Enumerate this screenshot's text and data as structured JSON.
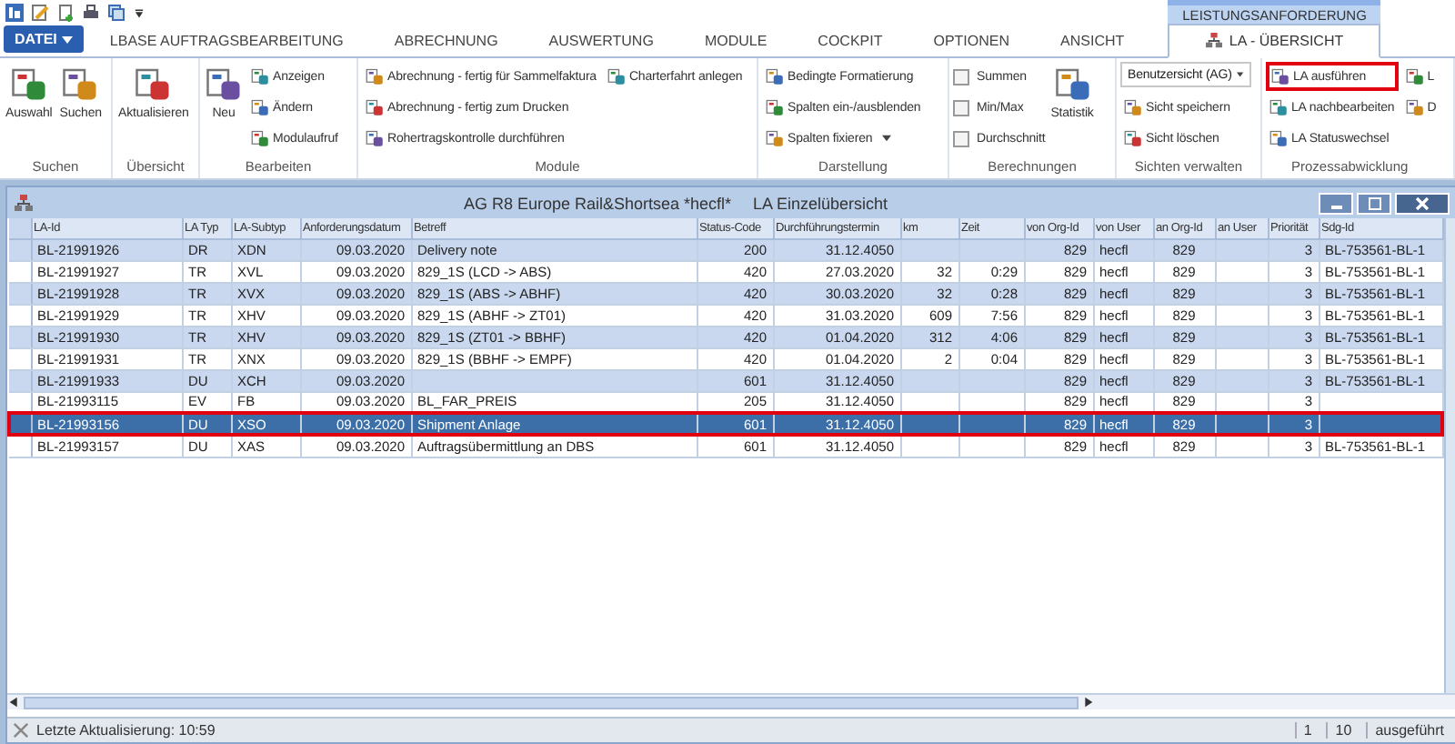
{
  "file_button": "DATEI",
  "context_group": "LEISTUNGSANFORDERUNG",
  "tabs": [
    {
      "label": "LBASE AUFTRAGSBEARBEITUNG",
      "selected": false
    },
    {
      "label": "ABRECHNUNG",
      "selected": false
    },
    {
      "label": "AUSWERTUNG",
      "selected": false
    },
    {
      "label": "MODULE",
      "selected": false
    },
    {
      "label": "COCKPIT",
      "selected": false
    },
    {
      "label": "OPTIONEN",
      "selected": false
    },
    {
      "label": "ANSICHT",
      "selected": false
    },
    {
      "label": "LA - ÜBERSICHT",
      "selected": true
    }
  ],
  "ribbon_groups": [
    {
      "label": "Suchen",
      "columns": [
        [
          {
            "kind": "large",
            "label": "Auswahl"
          }
        ],
        [
          {
            "kind": "large",
            "label": "Suchen"
          }
        ]
      ]
    },
    {
      "label": "Übersicht",
      "columns": [
        [
          {
            "kind": "large",
            "label": "Aktualisieren"
          }
        ]
      ]
    },
    {
      "label": "Bearbeiten",
      "columns": [
        [
          {
            "kind": "large",
            "label": "Neu"
          }
        ],
        [
          {
            "kind": "small",
            "label": "Anzeigen"
          },
          {
            "kind": "small",
            "label": "Ändern"
          },
          {
            "kind": "small",
            "label": "Modulaufruf"
          }
        ]
      ]
    },
    {
      "label": "Module",
      "columns": [
        [
          {
            "kind": "small",
            "label": "Abrechnung - fertig für Sammelfaktura"
          },
          {
            "kind": "small",
            "label": "Abrechnung - fertig zum Drucken"
          },
          {
            "kind": "small",
            "label": "Rohertragskontrolle durchführen"
          }
        ],
        [
          {
            "kind": "small",
            "label": "Charterfahrt anlegen"
          }
        ]
      ]
    },
    {
      "label": "Darstellung",
      "columns": [
        [
          {
            "kind": "small",
            "label": "Bedingte Formatierung"
          },
          {
            "kind": "small",
            "label": "Spalten ein-/ausblenden"
          },
          {
            "kind": "dropdown",
            "label": "Spalten fixieren"
          }
        ]
      ]
    },
    {
      "label": "Berechnungen",
      "columns": [
        [
          {
            "kind": "checkbox",
            "label": "Summen",
            "checked": false
          },
          {
            "kind": "checkbox",
            "label": "Min/Max",
            "checked": false
          },
          {
            "kind": "checkbox",
            "label": "Durchschnitt",
            "checked": false
          }
        ],
        [
          {
            "kind": "large",
            "label": "Statistik"
          }
        ]
      ]
    },
    {
      "label": "Sichten verwalten",
      "columns": [
        [
          {
            "kind": "combo",
            "label": "Benutzersicht (AG)"
          },
          {
            "kind": "small",
            "label": "Sicht speichern"
          },
          {
            "kind": "small",
            "label": "Sicht löschen"
          }
        ]
      ]
    },
    {
      "label": "Prozessabwicklung",
      "columns": [
        [
          {
            "kind": "small",
            "label": "LA ausführen",
            "marked": true
          },
          {
            "kind": "small",
            "label": "LA nachbearbeiten",
            "marked": false
          },
          {
            "kind": "small",
            "label": "LA Statuswechsel",
            "marked": false
          }
        ],
        [
          {
            "kind": "small",
            "label": "L",
            "marked": false
          },
          {
            "kind": "small",
            "label": "D",
            "marked": false
          }
        ]
      ]
    }
  ],
  "window": {
    "title": "AG R8 Europe Rail&Shortsea *hecfl*",
    "subtitle": "LA Einzelübersicht"
  },
  "table": {
    "columns": [
      "LA-Id",
      "LA Typ",
      "LA-Subtyp",
      "Anforderungsdatum",
      "Betreff",
      "Status-Code",
      "Durchführungstermin",
      "km",
      "Zeit",
      "von Org-Id",
      "von User",
      "an Org-Id",
      "an User",
      "Priorität",
      "Sdg-Id"
    ],
    "rows": [
      {
        "cells": [
          "BL-21991926",
          "DR",
          "XDN",
          "09.03.2020",
          "Delivery note",
          "200",
          "31.12.4050",
          "",
          "",
          "829",
          "hecfl",
          "829",
          "",
          "3",
          "BL-753561-BL-1"
        ],
        "selected": false,
        "marked": false
      },
      {
        "cells": [
          "BL-21991927",
          "TR",
          "XVL",
          "09.03.2020",
          "829_1S (LCD -> ABS)",
          "420",
          "27.03.2020",
          "32",
          "0:29",
          "829",
          "hecfl",
          "829",
          "",
          "3",
          "BL-753561-BL-1"
        ],
        "selected": false,
        "marked": false
      },
      {
        "cells": [
          "BL-21991928",
          "TR",
          "XVX",
          "09.03.2020",
          "829_1S (ABS -> ABHF)",
          "420",
          "30.03.2020",
          "32",
          "0:28",
          "829",
          "hecfl",
          "829",
          "",
          "3",
          "BL-753561-BL-1"
        ],
        "selected": false,
        "marked": false
      },
      {
        "cells": [
          "BL-21991929",
          "TR",
          "XHV",
          "09.03.2020",
          "829_1S (ABHF -> ZT01)",
          "420",
          "31.03.2020",
          "609",
          "7:56",
          "829",
          "hecfl",
          "829",
          "",
          "3",
          "BL-753561-BL-1"
        ],
        "selected": false,
        "marked": false
      },
      {
        "cells": [
          "BL-21991930",
          "TR",
          "XHV",
          "09.03.2020",
          "829_1S (ZT01 -> BBHF)",
          "420",
          "01.04.2020",
          "312",
          "4:06",
          "829",
          "hecfl",
          "829",
          "",
          "3",
          "BL-753561-BL-1"
        ],
        "selected": false,
        "marked": false
      },
      {
        "cells": [
          "BL-21991931",
          "TR",
          "XNX",
          "09.03.2020",
          "829_1S (BBHF -> EMPF)",
          "420",
          "01.04.2020",
          "2",
          "0:04",
          "829",
          "hecfl",
          "829",
          "",
          "3",
          "BL-753561-BL-1"
        ],
        "selected": false,
        "marked": false
      },
      {
        "cells": [
          "BL-21991933",
          "DU",
          "XCH",
          "09.03.2020",
          "",
          "601",
          "31.12.4050",
          "",
          "",
          "829",
          "hecfl",
          "829",
          "",
          "3",
          "BL-753561-BL-1"
        ],
        "selected": false,
        "marked": false
      },
      {
        "cells": [
          "BL-21993115",
          "EV",
          "FB",
          "09.03.2020",
          "BL_FAR_PREIS",
          "205",
          "31.12.4050",
          "",
          "",
          "829",
          "hecfl",
          "829",
          "",
          "3",
          ""
        ],
        "selected": false,
        "marked": false
      },
      {
        "cells": [
          "BL-21993156",
          "DU",
          "XSO",
          "09.03.2020",
          "Shipment Anlage",
          "601",
          "31.12.4050",
          "",
          "",
          "829",
          "hecfl",
          "829",
          "",
          "3",
          ""
        ],
        "selected": true,
        "marked": true
      },
      {
        "cells": [
          "BL-21993157",
          "DU",
          "XAS",
          "09.03.2020",
          "Auftragsübermittlung an DBS",
          "601",
          "31.12.4050",
          "",
          "",
          "829",
          "hecfl",
          "829",
          "",
          "3",
          "BL-753561-BL-1"
        ],
        "selected": false,
        "marked": false
      }
    ]
  },
  "status_bar": {
    "text": "Letzte Aktualisierung: 10:59",
    "panels": [
      "1",
      "10",
      "ausgeführt"
    ]
  }
}
